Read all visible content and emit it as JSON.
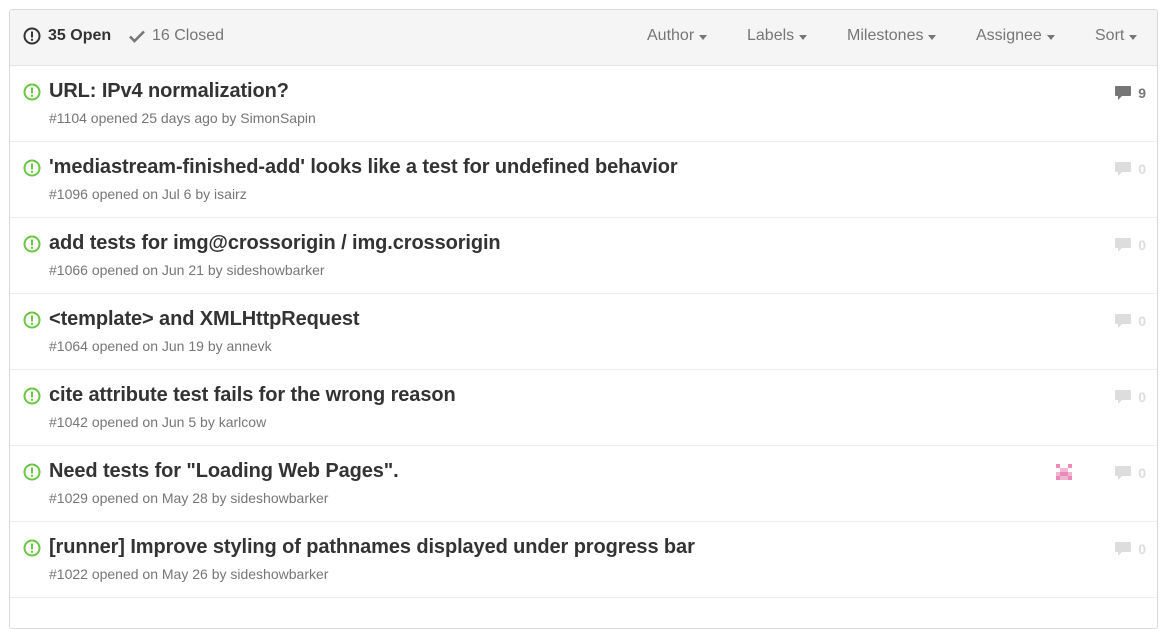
{
  "header": {
    "open_label": "35 Open",
    "closed_label": "16 Closed",
    "filters": {
      "author": "Author",
      "labels": "Labels",
      "milestones": "Milestones",
      "assignee": "Assignee",
      "sort": "Sort"
    }
  },
  "colors": {
    "open_green": "#6cc644",
    "muted": "#767676",
    "comment_zero": "#dddddd"
  },
  "issues": [
    {
      "title": "URL: IPv4 normalization?",
      "number": "#1104",
      "opened": "opened 25 days ago by",
      "author": "SimonSapin",
      "comments": "9"
    },
    {
      "title": "'mediastream-finished-add' looks like a test for undefined behavior",
      "number": "#1096",
      "opened": "opened on Jul 6 by",
      "author": "isairz",
      "comments": "0"
    },
    {
      "title": "add tests for img@crossorigin / img.crossorigin",
      "number": "#1066",
      "opened": "opened on Jun 21 by",
      "author": "sideshowbarker",
      "comments": "0"
    },
    {
      "title": "<template> and XMLHttpRequest",
      "number": "#1064",
      "opened": "opened on Jun 19 by",
      "author": "annevk",
      "comments": "0"
    },
    {
      "title": "cite attribute test fails for the wrong reason",
      "number": "#1042",
      "opened": "opened on Jun 5 by",
      "author": "karlcow",
      "comments": "0"
    },
    {
      "title": "Need tests for \"Loading Web Pages\".",
      "number": "#1029",
      "opened": "opened on May 28 by",
      "author": "sideshowbarker",
      "comments": "0"
    },
    {
      "title": "[runner] Improve styling of pathnames displayed under progress bar",
      "number": "#1022",
      "opened": "opened on May 26 by",
      "author": "sideshowbarker",
      "comments": "0"
    }
  ]
}
